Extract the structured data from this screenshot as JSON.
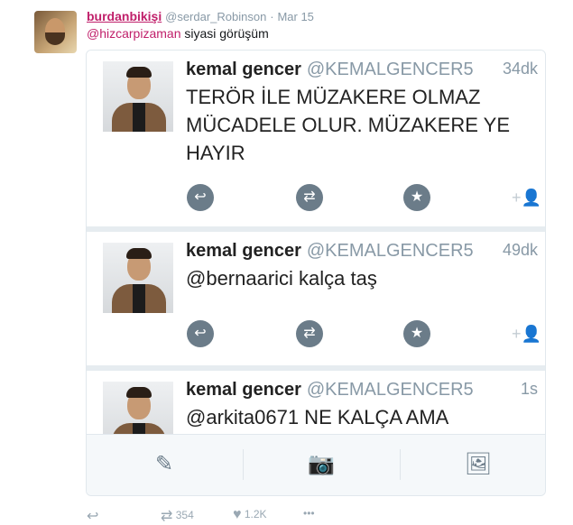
{
  "outer_tweet": {
    "author_name": "burdanbikişi",
    "author_handle": "@serdar_Robinson",
    "separator": "·",
    "date": "Mar 15",
    "mention": "@hizcarpizaman",
    "text": "siyasi görüşüm"
  },
  "embedded_tweets": [
    {
      "name": "kemal gencer",
      "handle": "@KEMALGENCER5",
      "time": "34dk",
      "text": "TERÖR İLE MÜZAKERE OLMAZ MÜCADELE OLUR. MÜZAKERE YE HAYIR"
    },
    {
      "name": "kemal gencer",
      "handle": "@KEMALGENCER5",
      "time": "49dk",
      "text": "@bernaarici kalça taş"
    },
    {
      "name": "kemal gencer",
      "handle": "@KEMALGENCER5",
      "time": "1s",
      "text": "@arkita0671 NE KALÇA AMA"
    }
  ],
  "footer": {
    "retweet_count": "354",
    "like_count": "1.2K",
    "more_label": "•••"
  },
  "icons": {
    "reply": "reply-icon",
    "retweet": "retweet-icon",
    "favorite": "star-icon",
    "follow": "follow-icon",
    "compose": "compose-icon",
    "camera": "camera-icon",
    "image": "image-icon",
    "like": "heart-icon"
  },
  "colors": {
    "author_pink": "#c01f6a",
    "muted_gray": "#8899a6",
    "action_circle": "#6b7c89"
  }
}
